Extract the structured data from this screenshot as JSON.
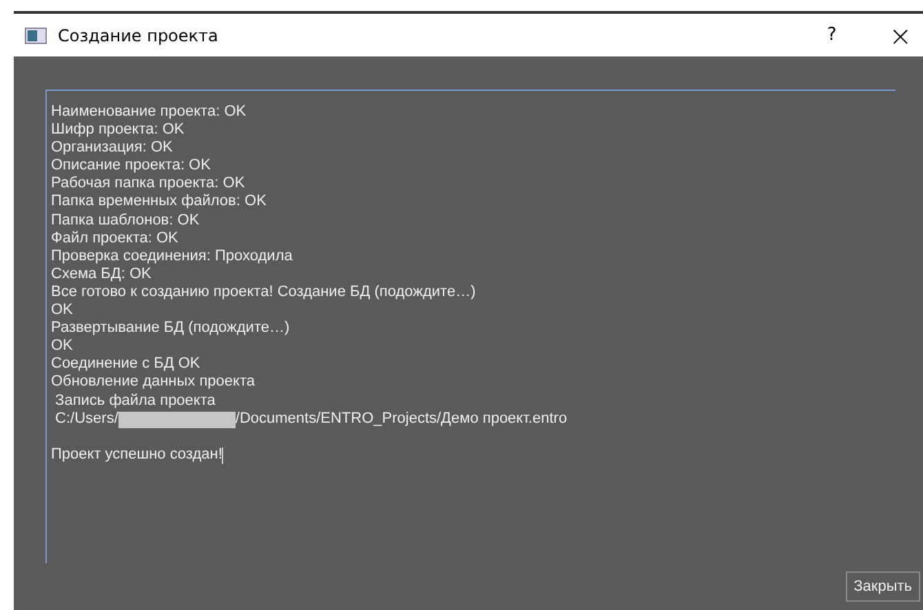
{
  "window": {
    "title": "Создание проекта",
    "help": "?",
    "close": "×"
  },
  "log": [
    {
      "kind": "text",
      "text": "Наименование проекта: OK"
    },
    {
      "kind": "text",
      "text": "Шифр проекта: OK"
    },
    {
      "kind": "text",
      "text": "Организация: OK"
    },
    {
      "kind": "text",
      "text": "Описание проекта: OK"
    },
    {
      "kind": "text",
      "text": "Рабочая папка проекта: OK"
    },
    {
      "kind": "text",
      "text": "Папка временных файлов: OK"
    },
    {
      "kind": "text",
      "text": "Папка шаблонов: OK"
    },
    {
      "kind": "text",
      "text": "Файл проекта: OK"
    },
    {
      "kind": "text",
      "text": "Проверка соединения: Проходила"
    },
    {
      "kind": "text",
      "text": "Схема БД: OK"
    },
    {
      "kind": "text",
      "text": "Все готово к созданию проекта! Создание БД (подождите…)"
    },
    {
      "kind": "text",
      "text": "OK"
    },
    {
      "kind": "text",
      "text": "Развертывание БД (подождите…)"
    },
    {
      "kind": "text",
      "text": "OK"
    },
    {
      "kind": "text",
      "text": "Соединение с БД OK"
    },
    {
      "kind": "text",
      "text": "Обновление данных проекта"
    },
    {
      "kind": "text",
      "text": " Запись файла проекта"
    },
    {
      "kind": "path",
      "before": " C:/Users/",
      "after": "/Documents/ENTRO_Projects/Демо проект.entro"
    },
    {
      "kind": "blank"
    },
    {
      "kind": "caret",
      "text": "Проект успешно создан!"
    }
  ],
  "buttons": [
    "Закрыть"
  ]
}
